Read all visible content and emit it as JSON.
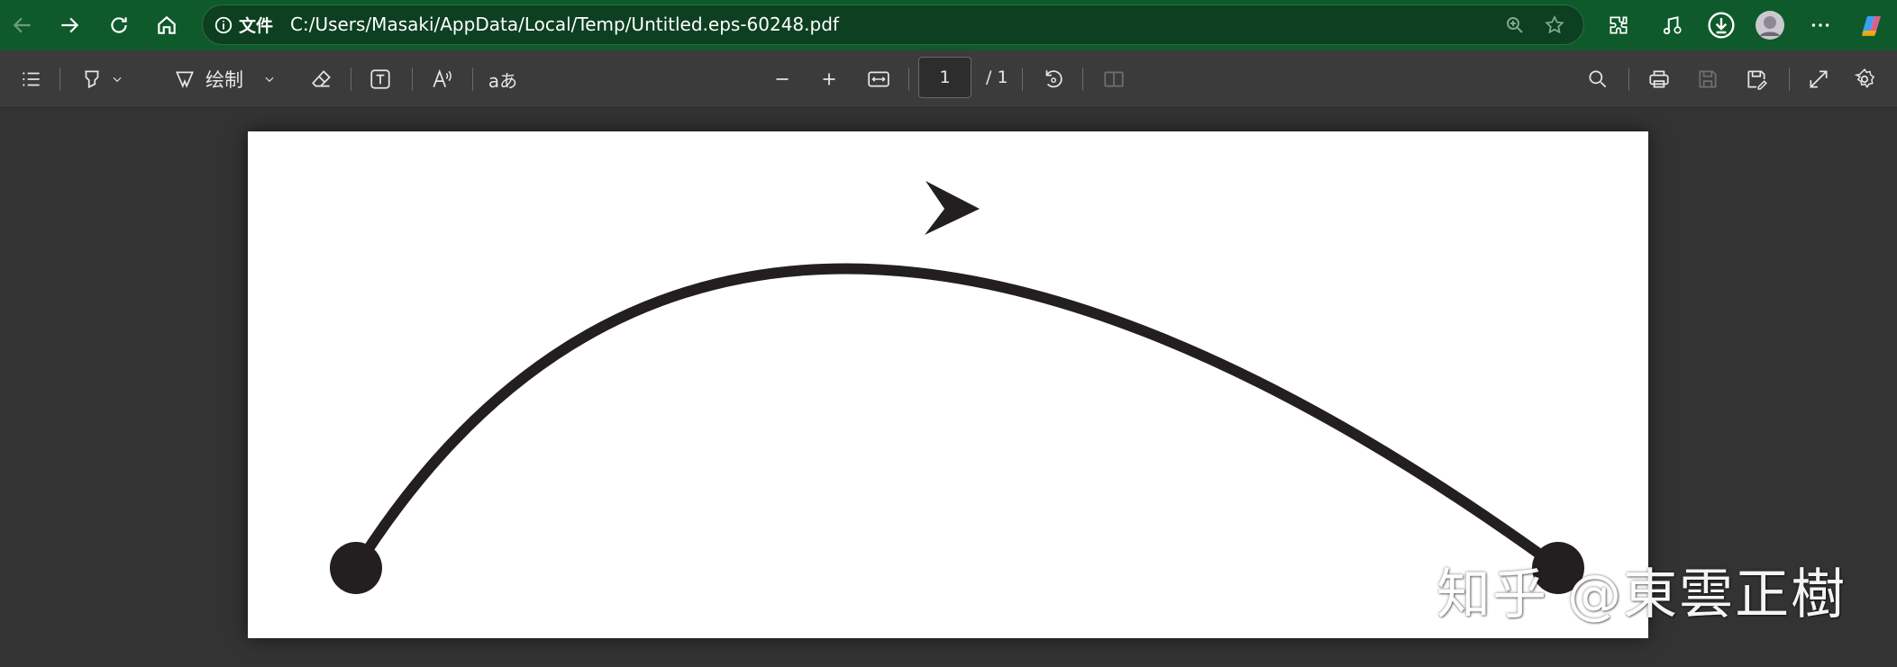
{
  "browser": {
    "address_prefix": "文件",
    "url": "C:/Users/Masaki/AppData/Local/Temp/Untitled.eps-60248.pdf",
    "icons": [
      "back-icon",
      "forward-icon",
      "refresh-icon",
      "home-icon",
      "info-icon",
      "zoom-icon",
      "favorite-star-icon",
      "extensions-icon",
      "media-icon",
      "download-icon",
      "profile-avatar",
      "more-icon",
      "copilot-icon"
    ]
  },
  "pdf_toolbar": {
    "draw_label": "绘制",
    "page_current": "1",
    "page_total": "/ 1",
    "translate_glyph": "aあ"
  },
  "watermark": {
    "text": "知乎 @東雲正樹"
  },
  "colors": {
    "titlebar": "#0f5a2b",
    "toolbar": "#3b3b3b",
    "viewer_bg": "#333333",
    "page_bg": "#ffffff",
    "arc": "#231f20"
  }
}
